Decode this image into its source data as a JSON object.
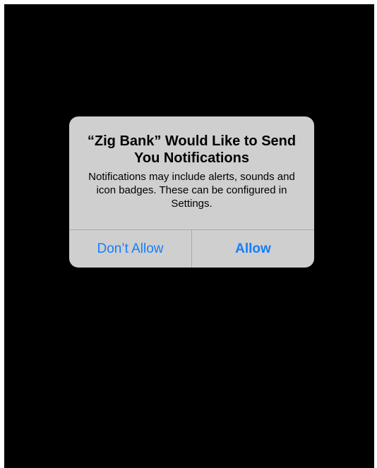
{
  "alert": {
    "title": "“Zig Bank” Would Like to Send You Notifications",
    "message": "Notifications may include alerts, sounds and icon badges. These can be configured in Settings.",
    "buttons": {
      "deny_label": "Don’t Allow",
      "allow_label": "Allow"
    }
  },
  "colors": {
    "background": "#000000",
    "alert_background": "#cfcfcf",
    "button_text": "#147efb",
    "divider": "#a9a9a9"
  }
}
